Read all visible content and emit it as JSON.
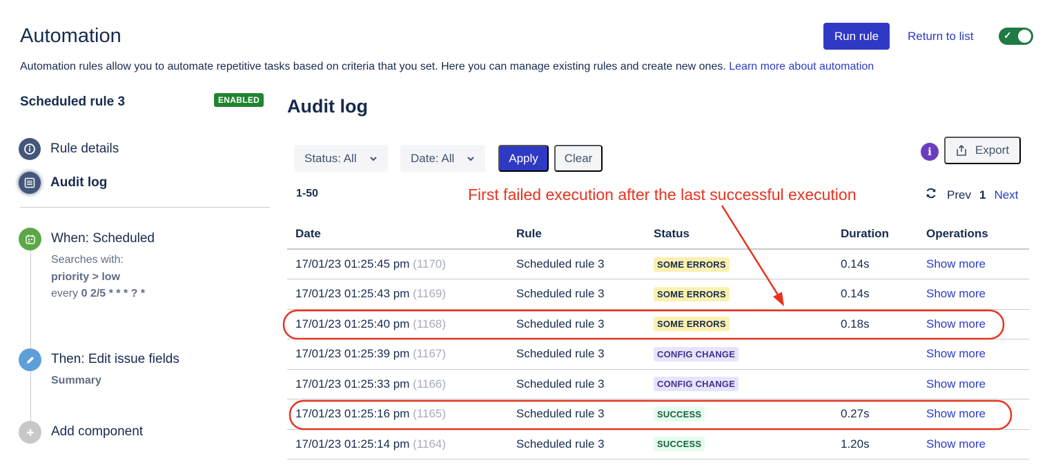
{
  "header": {
    "title": "Automation",
    "description": "Automation rules allow you to automate repetitive tasks based on criteria that you set. Here you can manage existing rules and create new ones.",
    "learn_more_link": "Learn more about automation",
    "run_rule_label": "Run rule",
    "return_link": "Return to list",
    "rule_toggle_enabled": true
  },
  "sidebar": {
    "rule_name": "Scheduled rule 3",
    "status_badge": "ENABLED",
    "nav": [
      {
        "label": "Rule details",
        "icon": "info-icon",
        "active": false
      },
      {
        "label": "Audit log",
        "icon": "list-icon",
        "active": true
      }
    ],
    "components": {
      "trigger": {
        "title": "When: Scheduled",
        "line1": "Searches with:",
        "jql": "priority > low",
        "every_prefix": "every",
        "cron": "0 2/5 * * * ? *",
        "icon": "calendar-icon",
        "color": "#5aa847"
      },
      "action": {
        "title": "Then: Edit issue fields",
        "field": "Summary",
        "icon": "pencil-icon",
        "color": "#5e9fdb"
      },
      "add": {
        "title": "Add component",
        "icon": "plus-icon",
        "color": "#c8c8c8"
      }
    }
  },
  "main": {
    "title": "Audit log",
    "filters": {
      "status_label": "Status: All",
      "date_label": "Date: All",
      "apply_label": "Apply",
      "clear_label": "Clear"
    },
    "export_label": "Export",
    "range": "1-50",
    "pager": {
      "prev": "Prev",
      "current": "1",
      "next": "Next"
    },
    "annotation": "First failed execution after the last successful execution",
    "table": {
      "columns": [
        "Date",
        "Rule",
        "Status",
        "Duration",
        "Operations"
      ],
      "rows": [
        {
          "date": "17/01/23 01:25:45 pm",
          "id": "(1170)",
          "rule": "Scheduled rule 3",
          "status": "SOME ERRORS",
          "status_type": "some-errors",
          "duration": "0.14s",
          "op": "Show more"
        },
        {
          "date": "17/01/23 01:25:43 pm",
          "id": "(1169)",
          "rule": "Scheduled rule 3",
          "status": "SOME ERRORS",
          "status_type": "some-errors",
          "duration": "0.14s",
          "op": "Show more"
        },
        {
          "date": "17/01/23 01:25:40 pm",
          "id": "(1168)",
          "rule": "Scheduled rule 3",
          "status": "SOME ERRORS",
          "status_type": "some-errors",
          "duration": "0.18s",
          "op": "Show more",
          "highlighted": true
        },
        {
          "date": "17/01/23 01:25:39 pm",
          "id": "(1167)",
          "rule": "Scheduled rule 3",
          "status": "CONFIG CHANGE",
          "status_type": "config-change",
          "duration": "",
          "op": "Show more"
        },
        {
          "date": "17/01/23 01:25:33 pm",
          "id": "(1166)",
          "rule": "Scheduled rule 3",
          "status": "CONFIG CHANGE",
          "status_type": "config-change",
          "duration": "",
          "op": "Show more"
        },
        {
          "date": "17/01/23 01:25:16 pm",
          "id": "(1165)",
          "rule": "Scheduled rule 3",
          "status": "SUCCESS",
          "status_type": "success",
          "duration": "0.27s",
          "op": "Show more",
          "highlighted": true
        },
        {
          "date": "17/01/23 01:25:14 pm",
          "id": "(1164)",
          "rule": "Scheduled rule 3",
          "status": "SUCCESS",
          "status_type": "success",
          "duration": "1.20s",
          "op": "Show more"
        }
      ]
    }
  },
  "colors": {
    "primary": "#3039c4",
    "link": "#2c3ac8",
    "annotation": "#e8321f",
    "enabled": "#218532"
  }
}
